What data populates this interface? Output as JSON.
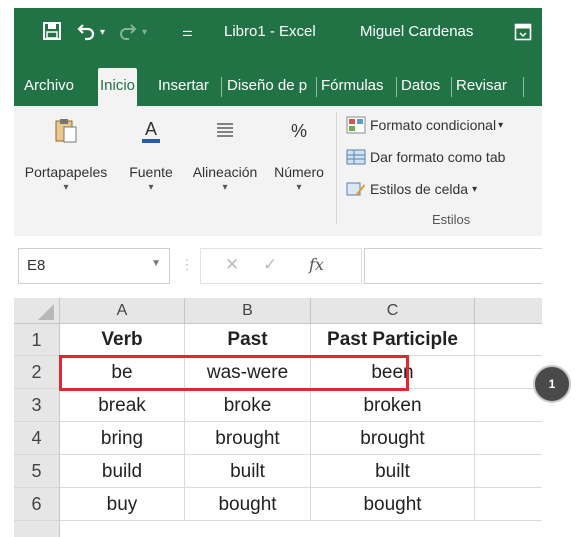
{
  "titlebar": {
    "file": "Libro1 - Excel",
    "user": "Miguel Cardenas"
  },
  "tabs": [
    "Archivo",
    "Inicio",
    "Insertar",
    "Diseño de p",
    "Fórmulas",
    "Datos",
    "Revisar"
  ],
  "ribbon": {
    "groups": [
      "Portapapeles",
      "Fuente",
      "Alineación",
      "Número"
    ],
    "styles": [
      "Formato condicional",
      "Dar formato como tab",
      "Estilos de celda"
    ],
    "styles_group_label": "Estilos"
  },
  "formula_bar": {
    "name_box": "E8",
    "fx": "fx",
    "value": ""
  },
  "columns": [
    "A",
    "B",
    "C"
  ],
  "rows": [
    {
      "num": "1",
      "cells": [
        "Verb",
        "Past",
        "Past Participle"
      ]
    },
    {
      "num": "2",
      "cells": [
        "be",
        "was-were",
        "been"
      ]
    },
    {
      "num": "3",
      "cells": [
        "break",
        "broke",
        "broken"
      ]
    },
    {
      "num": "4",
      "cells": [
        "bring",
        "brought",
        "brought"
      ]
    },
    {
      "num": "5",
      "cells": [
        "build",
        "built",
        "built"
      ]
    },
    {
      "num": "6",
      "cells": [
        "buy",
        "bought",
        "bought"
      ]
    }
  ],
  "marker": "1",
  "colors": {
    "excel_green": "#217346",
    "highlight": "#e0282e"
  }
}
